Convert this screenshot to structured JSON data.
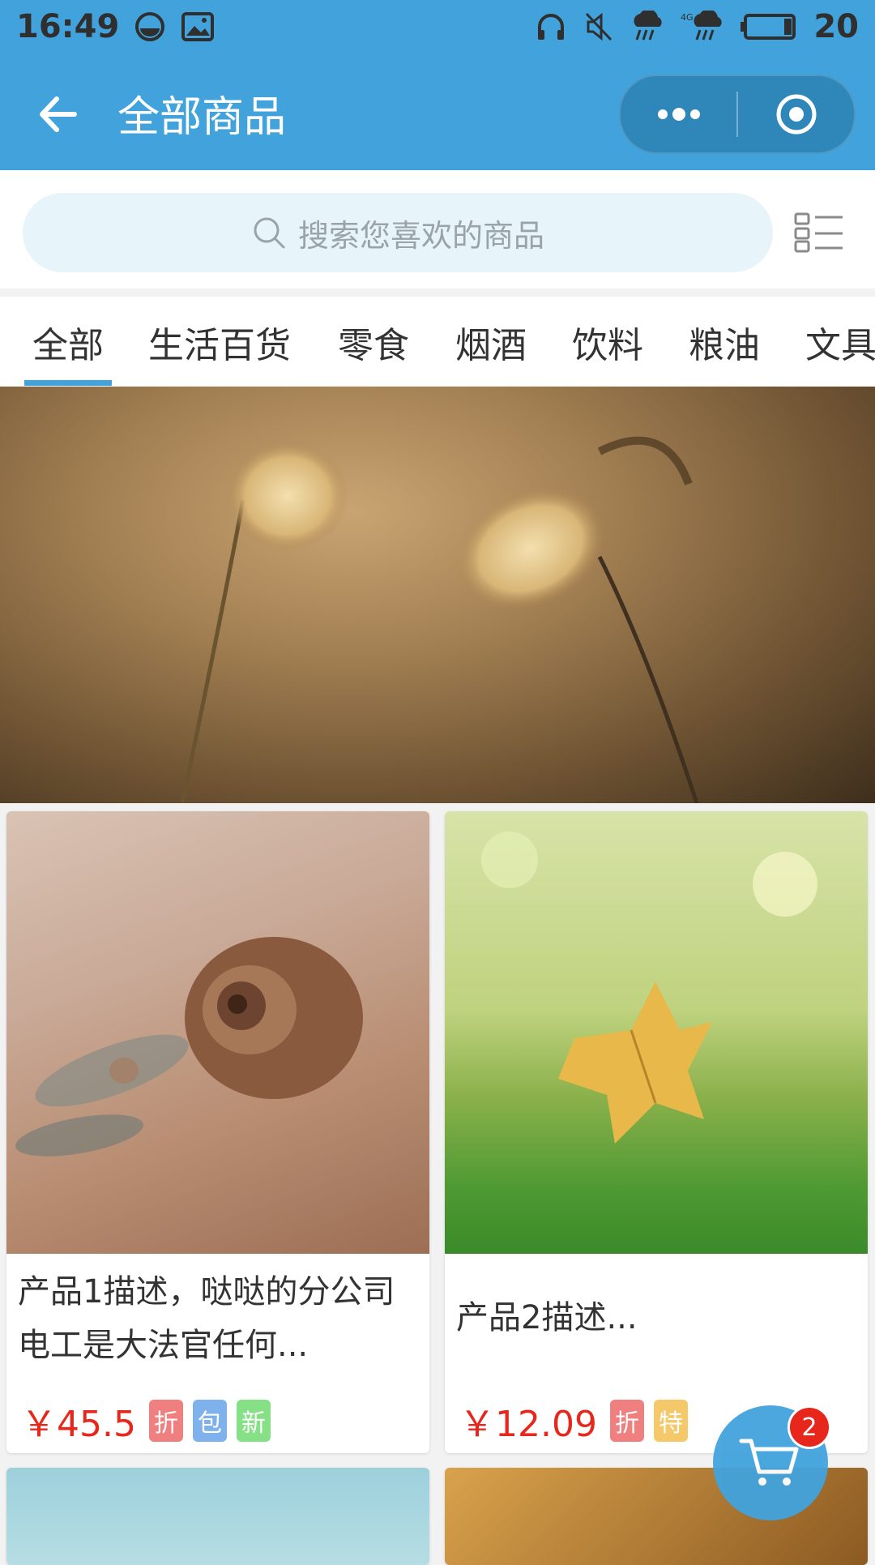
{
  "status_bar": {
    "time": "16:49",
    "battery": "20",
    "network": "4G",
    "icons": [
      "face-icon",
      "image-icon",
      "headphones-icon",
      "mute-icon",
      "rain-icon",
      "rain-icon",
      "battery-icon"
    ]
  },
  "nav": {
    "title": "全部商品",
    "back_icon": "arrow-left-icon",
    "more_icon": "more-dots-icon",
    "close_icon": "target-circle-icon"
  },
  "search": {
    "placeholder": "搜索您喜欢的商品",
    "icon": "search-icon",
    "layout_icon": "list-layout-icon"
  },
  "tabs": [
    {
      "label": "全部",
      "active": true
    },
    {
      "label": "生活百货"
    },
    {
      "label": "零食"
    },
    {
      "label": "烟酒"
    },
    {
      "label": "饮料"
    },
    {
      "label": "粮油"
    },
    {
      "label": "文具"
    }
  ],
  "products": [
    {
      "description": "产品1描述，哒哒的分公司电工是大法官任何...",
      "price": "￥45.5",
      "tags": [
        {
          "label": "折",
          "color": "#f08080"
        },
        {
          "label": "包",
          "color": "#7fb2ec"
        },
        {
          "label": "新",
          "color": "#86e186"
        }
      ]
    },
    {
      "description": "产品2描述...",
      "price": "￥12.09",
      "tags": [
        {
          "label": "折",
          "color": "#f08080"
        },
        {
          "label": "特",
          "color": "#f5c96a"
        }
      ]
    }
  ],
  "cart": {
    "icon": "cart-icon",
    "badge_count": "2"
  },
  "colors": {
    "primary": "#42a3dc",
    "price": "#e8271c",
    "search_bg": "#e7f5fa"
  }
}
